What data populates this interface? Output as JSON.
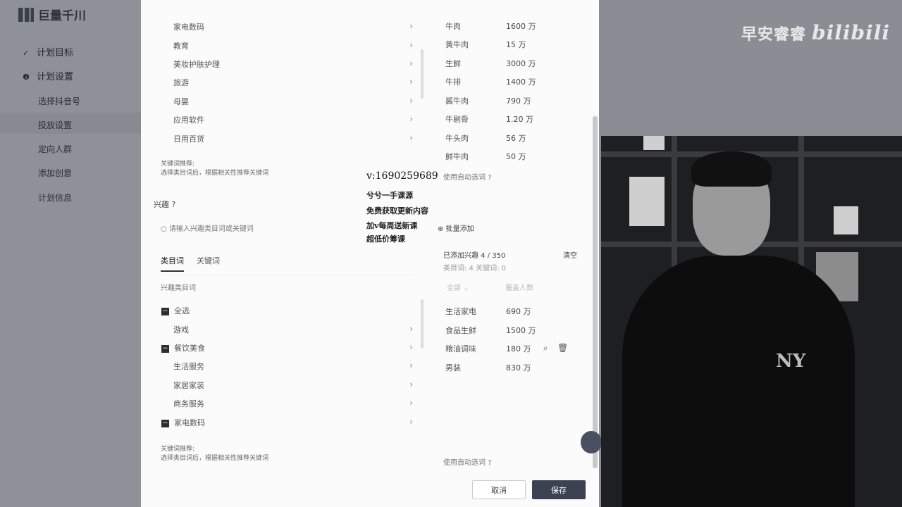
{
  "app": {
    "logo_text": "巨量千川",
    "nav": [
      {
        "label": "计划目标",
        "icon": "check-icon"
      },
      {
        "label": "计划设置",
        "icon": "step-2-icon"
      },
      {
        "label": "选择抖音号"
      },
      {
        "label": "投放设置"
      },
      {
        "label": "定向人群"
      },
      {
        "label": "添加创意"
      },
      {
        "label": "计划信息"
      }
    ]
  },
  "top_section": {
    "categories": [
      "家电数码",
      "教育",
      "美妆护肤护理",
      "旅游",
      "母婴",
      "应用软件",
      "日用百货"
    ],
    "hint_title": "关键词推荐:",
    "hint_text": "选择类目词后，根据相关性推荐关键词",
    "keywords": [
      {
        "name": "牛肉",
        "value": "1600 万"
      },
      {
        "name": "黄牛肉",
        "value": "15 万"
      },
      {
        "name": "生鲜",
        "value": "3000 万"
      },
      {
        "name": "牛排",
        "value": "1400 万"
      },
      {
        "name": "酱牛肉",
        "value": "790 万"
      },
      {
        "name": "牛剔骨",
        "value": "1.20 万"
      },
      {
        "name": "牛头肉",
        "value": "56 万"
      },
      {
        "name": "鲜牛肉",
        "value": "50 万"
      }
    ],
    "auto_select": "使用自动选词"
  },
  "promo": {
    "contact": "v:1690259689",
    "lines": [
      "兮兮一手课源",
      "免费获取更新内容",
      "加v每周送新课",
      "超低价筹课"
    ]
  },
  "interest": {
    "label": "兴趣",
    "input_placeholder": "请输入兴趣类目词或关键词",
    "batch_add": "批量添加",
    "tabs": [
      "类目词",
      "关键词"
    ],
    "section_title": "兴趣类目词",
    "select_all": "全选",
    "categories": [
      {
        "label": "游戏",
        "checked": false
      },
      {
        "label": "餐饮美食",
        "checked": true
      },
      {
        "label": "生活服务",
        "checked": false
      },
      {
        "label": "家居家装",
        "checked": false
      },
      {
        "label": "商务服务",
        "checked": false
      },
      {
        "label": "家电数码",
        "checked": true
      }
    ],
    "added_summary": "已添加兴趣 4 / 350",
    "clear": "清空",
    "counts": "类目词: 4    关键词: 0",
    "filter_all": "全部",
    "filter_cover": "覆盖人数",
    "added": [
      {
        "name": "生活家电",
        "value": "690 万"
      },
      {
        "name": "食品生鲜",
        "value": "1500 万"
      },
      {
        "name": "粮油调味",
        "value": "180 万"
      },
      {
        "name": "男装",
        "value": "830 万"
      }
    ],
    "hint_title": "关键词推荐:",
    "hint_text": "选择类目词后，根据相关性推荐关键词",
    "auto_select": "使用自动选词"
  },
  "footer": {
    "cancel": "取消",
    "save": "保存"
  },
  "watermark": {
    "text": "早安睿睿",
    "brand": "bilibili"
  }
}
